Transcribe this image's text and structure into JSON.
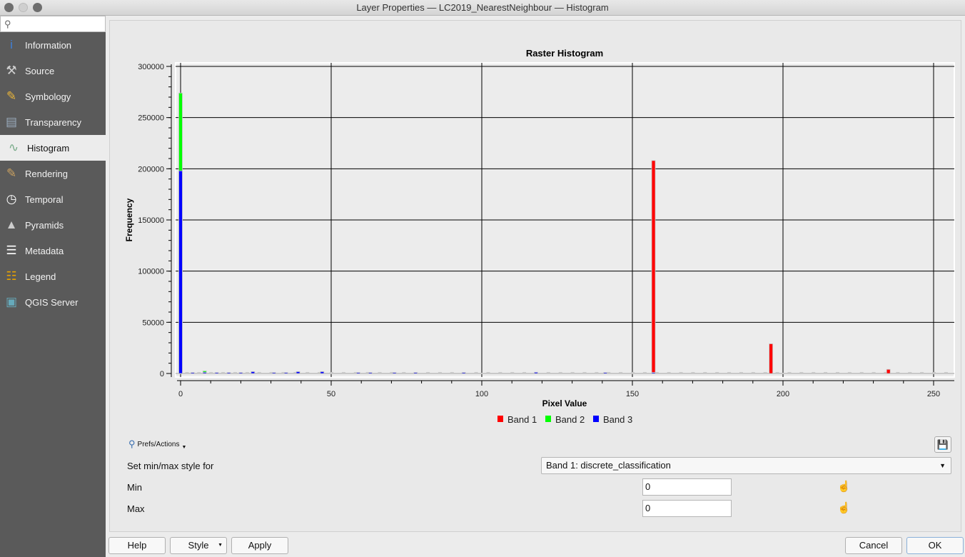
{
  "window": {
    "title": "Layer Properties — LC2019_NearestNeighbour — Histogram"
  },
  "sidebar": {
    "search_placeholder": "",
    "items": [
      {
        "label": "Information",
        "icon": "info-icon"
      },
      {
        "label": "Source",
        "icon": "source-tools-icon"
      },
      {
        "label": "Symbology",
        "icon": "symbology-brush-icon"
      },
      {
        "label": "Transparency",
        "icon": "transparency-icon"
      },
      {
        "label": "Histogram",
        "icon": "histogram-icon",
        "active": true
      },
      {
        "label": "Rendering",
        "icon": "rendering-brush-icon"
      },
      {
        "label": "Temporal",
        "icon": "clock-icon"
      },
      {
        "label": "Pyramids",
        "icon": "pyramids-icon"
      },
      {
        "label": "Metadata",
        "icon": "metadata-icon"
      },
      {
        "label": "Legend",
        "icon": "legend-icon"
      },
      {
        "label": "QGIS Server",
        "icon": "qgis-server-icon"
      }
    ]
  },
  "chart_data": {
    "type": "bar",
    "title": "Raster Histogram",
    "xlabel": "Pixel Value",
    "ylabel": "Frequency",
    "xlim": [
      -2,
      257
    ],
    "ylim": [
      0,
      300000
    ],
    "xticks": [
      0,
      50,
      100,
      150,
      200,
      250
    ],
    "yticks": [
      0,
      50000,
      100000,
      150000,
      200000,
      250000,
      300000
    ],
    "grid": true,
    "legend_position": "bottom",
    "series": [
      {
        "name": "Band 1",
        "color": "#ff0000",
        "points": [
          [
            157,
            208000
          ],
          [
            196,
            29000
          ],
          [
            235,
            4000
          ]
        ]
      },
      {
        "name": "Band 2",
        "color": "#00ff00",
        "points": [
          [
            0,
            274000
          ],
          [
            8,
            2500
          ]
        ]
      },
      {
        "name": "Band 3",
        "color": "#0000ff",
        "points": [
          [
            0,
            198000
          ],
          [
            4,
            1000
          ],
          [
            8,
            1200
          ],
          [
            12,
            1000
          ],
          [
            16,
            1000
          ],
          [
            20,
            1000
          ],
          [
            24,
            1800
          ],
          [
            31,
            1000
          ],
          [
            35,
            1000
          ],
          [
            39,
            1800
          ],
          [
            47,
            1800
          ],
          [
            59,
            1000
          ],
          [
            63,
            1000
          ],
          [
            71,
            1000
          ],
          [
            78,
            1000
          ],
          [
            94,
            1000
          ],
          [
            118,
            1200
          ],
          [
            141,
            1000
          ],
          [
            157,
            1000
          ]
        ]
      }
    ]
  },
  "controls": {
    "prefs_label": "Prefs/Actions",
    "minmax_label": "Set min/max style for",
    "band_select": "Band 1: discrete_classification",
    "min_label": "Min",
    "min_value": "0",
    "max_label": "Max",
    "max_value": "0"
  },
  "buttons": {
    "help": "Help",
    "style": "Style",
    "apply": "Apply",
    "cancel": "Cancel",
    "ok": "OK"
  }
}
